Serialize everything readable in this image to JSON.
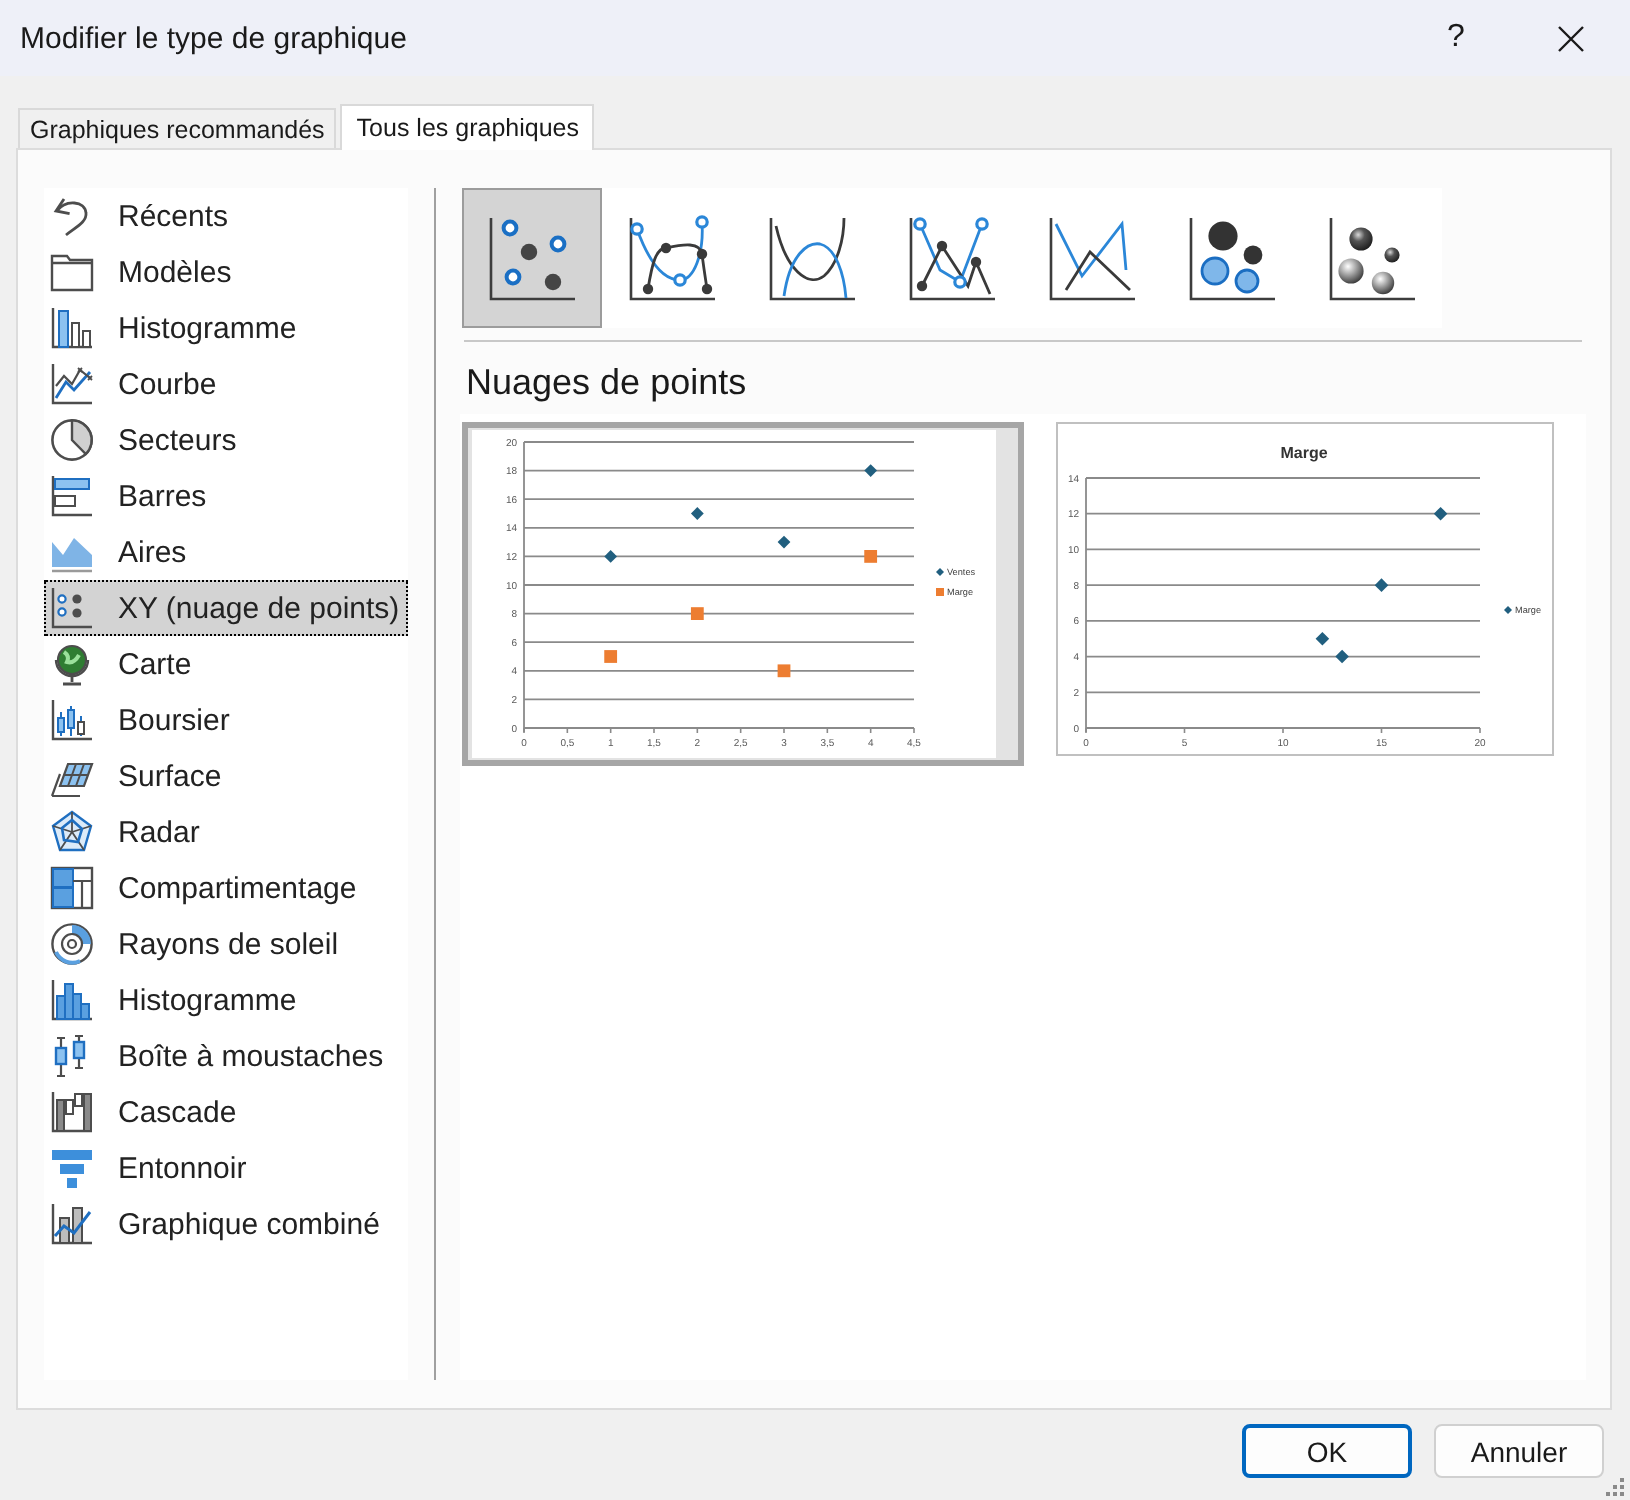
{
  "window": {
    "title": "Modifier le type de graphique",
    "help_button": "?"
  },
  "tabs": [
    {
      "label": "Graphiques recommandés",
      "selected": false
    },
    {
      "label": "Tous les graphiques",
      "selected": true
    }
  ],
  "chart_types": [
    {
      "label": "Récents",
      "selected": false
    },
    {
      "label": "Modèles",
      "selected": false
    },
    {
      "label": "Histogramme",
      "selected": false
    },
    {
      "label": "Courbe",
      "selected": false
    },
    {
      "label": "Secteurs",
      "selected": false
    },
    {
      "label": "Barres",
      "selected": false
    },
    {
      "label": "Aires",
      "selected": false
    },
    {
      "label": "XY (nuage de points)",
      "selected": true
    },
    {
      "label": "Carte",
      "selected": false
    },
    {
      "label": "Boursier",
      "selected": false
    },
    {
      "label": "Surface",
      "selected": false
    },
    {
      "label": "Radar",
      "selected": false
    },
    {
      "label": "Compartimentage",
      "selected": false
    },
    {
      "label": "Rayons de soleil",
      "selected": false
    },
    {
      "label": "Histogramme",
      "selected": false
    },
    {
      "label": "Boîte à moustaches",
      "selected": false
    },
    {
      "label": "Cascade",
      "selected": false
    },
    {
      "label": "Entonnoir",
      "selected": false
    },
    {
      "label": "Graphique combiné",
      "selected": false
    }
  ],
  "subtypes": [
    {
      "selected": true
    },
    {
      "selected": false
    },
    {
      "selected": false
    },
    {
      "selected": false
    },
    {
      "selected": false
    },
    {
      "selected": false
    },
    {
      "selected": false
    }
  ],
  "section_title": "Nuages de points",
  "previews": [
    {
      "selected": true,
      "chart_data": {
        "type": "scatter",
        "x": [
          1,
          2,
          3,
          4
        ],
        "series": [
          {
            "name": "Ventes",
            "color": "#215f7f",
            "values": [
              12,
              15,
              13,
              18
            ]
          },
          {
            "name": "Marge",
            "color": "#ed7d31",
            "values": [
              5,
              8,
              4,
              12
            ]
          }
        ],
        "xlim": [
          0,
          4.5
        ],
        "ylim": [
          0,
          20
        ],
        "xticks": [
          0,
          {
            "value": 0.5,
            "label": "0,5"
          },
          1,
          {
            "value": 1.5,
            "label": "1,5"
          },
          2,
          {
            "value": 2.5,
            "label": "2,5"
          },
          3,
          {
            "value": 3.5,
            "label": "3,5"
          },
          4,
          {
            "value": 4.5,
            "label": "4,5"
          }
        ],
        "yticks": [
          0,
          2,
          4,
          6,
          8,
          10,
          12,
          14,
          16,
          18,
          20
        ],
        "grid": true,
        "legend": true
      }
    },
    {
      "selected": false,
      "chart_data": {
        "type": "scatter",
        "title": "Marge",
        "x": [
          12,
          15,
          13,
          18
        ],
        "series": [
          {
            "name": "Marge",
            "color": "#215f7f",
            "values": [
              5,
              8,
              4,
              12
            ]
          }
        ],
        "xlim": [
          0,
          20
        ],
        "ylim": [
          0,
          14
        ],
        "xticks": [
          0,
          5,
          10,
          15,
          20
        ],
        "yticks": [
          0,
          2,
          4,
          6,
          8,
          10,
          12,
          14
        ],
        "grid": true,
        "legend": true
      }
    }
  ],
  "buttons": [
    {
      "label": "OK",
      "default": true
    },
    {
      "label": "Annuler",
      "default": false
    }
  ]
}
